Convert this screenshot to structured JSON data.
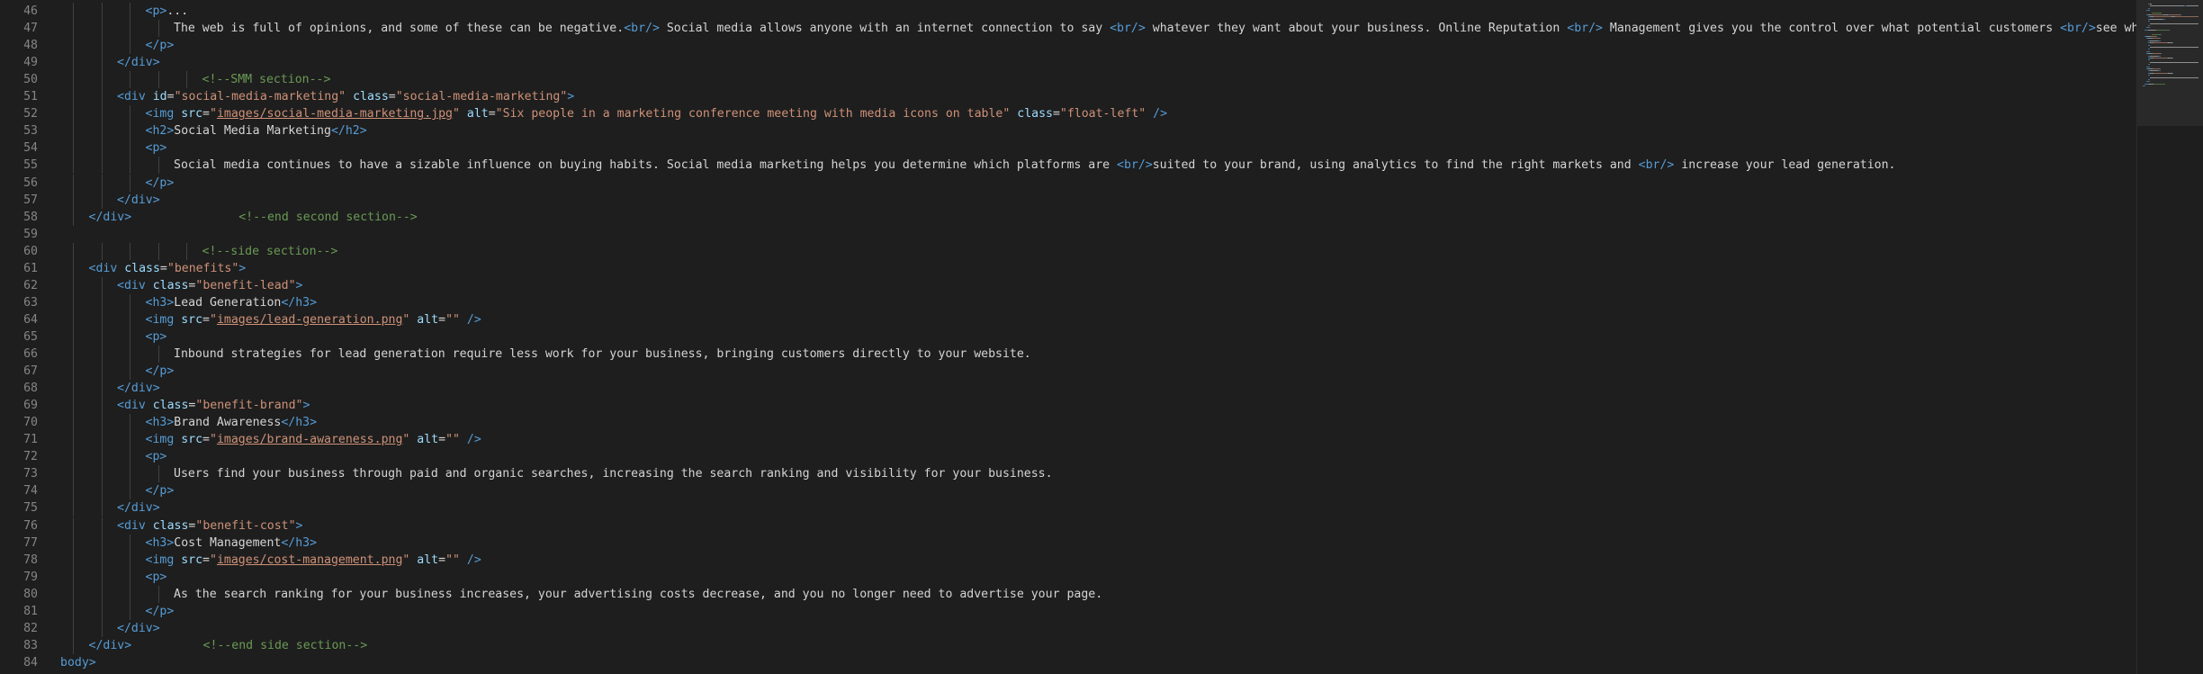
{
  "editor": {
    "theme_colors": {
      "background": "#1e1e1e",
      "line_number": "#858585",
      "punct": "#808080",
      "tag": "#569cd6",
      "attr": "#9cdcfe",
      "string": "#ce9178",
      "comment": "#6a9955",
      "text": "#d4d4d4"
    },
    "lines": [
      {
        "n": "46",
        "indent": 3,
        "tokens": [
          [
            "tag",
            "<p>"
          ],
          [
            "text",
            "..."
          ]
        ]
      },
      {
        "n": "46b",
        "hidden": true,
        "indent": 0,
        "tokens": []
      },
      {
        "n": "47",
        "indent": 4,
        "tokens": [
          [
            "text",
            "The web is full of opinions, and some of these can be negative."
          ],
          [
            "tag",
            "<br/>"
          ],
          [
            "text",
            " Social media allows anyone with an internet connection to say "
          ],
          [
            "tag",
            "<br/>"
          ],
          [
            "text",
            " whatever they want about your business. Online Reputation "
          ],
          [
            "tag",
            "<br/>"
          ],
          [
            "text",
            " Management gives you the control over what potential customers "
          ],
          [
            "tag",
            "<br/>"
          ],
          [
            "text",
            "see when they sea"
          ]
        ]
      },
      {
        "n": "48",
        "indent": 3,
        "tokens": [
          [
            "tag",
            "</p>"
          ]
        ]
      },
      {
        "n": "49",
        "indent": 2,
        "tokens": [
          [
            "tag",
            "</div>"
          ]
        ]
      },
      {
        "n": "50",
        "indent": 5,
        "tokens": [
          [
            "comment",
            "<!--SMM section-->"
          ]
        ]
      },
      {
        "n": "51",
        "indent": 2,
        "tokens": [
          [
            "tag",
            "<div"
          ],
          [
            "text",
            " "
          ],
          [
            "attr",
            "id"
          ],
          [
            "text",
            "="
          ],
          [
            "str",
            "\"social-media-marketing\""
          ],
          [
            "text",
            " "
          ],
          [
            "attr",
            "class"
          ],
          [
            "text",
            "="
          ],
          [
            "str",
            "\"social-media-marketing\""
          ],
          [
            "tag",
            ">"
          ]
        ]
      },
      {
        "n": "52",
        "indent": 3,
        "tokens": [
          [
            "tag",
            "<img"
          ],
          [
            "text",
            " "
          ],
          [
            "attr",
            "src"
          ],
          [
            "text",
            "="
          ],
          [
            "str",
            "\""
          ],
          [
            "link",
            "images/social-media-marketing.jpg"
          ],
          [
            "str",
            "\""
          ],
          [
            "text",
            " "
          ],
          [
            "attr",
            "alt"
          ],
          [
            "text",
            "="
          ],
          [
            "str",
            "\"Six people in a marketing conference meeting with media icons on table\""
          ],
          [
            "text",
            " "
          ],
          [
            "attr",
            "class"
          ],
          [
            "text",
            "="
          ],
          [
            "str",
            "\"float-left\""
          ],
          [
            "text",
            " "
          ],
          [
            "tag",
            "/>"
          ]
        ]
      },
      {
        "n": "53",
        "indent": 3,
        "tokens": [
          [
            "tag",
            "<h2>"
          ],
          [
            "text",
            "Social Media Marketing"
          ],
          [
            "tag",
            "</h2>"
          ]
        ]
      },
      {
        "n": "54",
        "indent": 3,
        "tokens": [
          [
            "tag",
            "<p>"
          ]
        ]
      },
      {
        "n": "55",
        "indent": 4,
        "tokens": [
          [
            "text",
            "Social media continues to have a sizable influence on buying habits. Social media marketing helps you determine which platforms are "
          ],
          [
            "tag",
            "<br/>"
          ],
          [
            "text",
            "suited to your brand, using analytics to find the right markets and "
          ],
          [
            "tag",
            "<br/>"
          ],
          [
            "text",
            " increase your lead generation."
          ]
        ]
      },
      {
        "n": "56",
        "indent": 3,
        "tokens": [
          [
            "tag",
            "</p>"
          ]
        ]
      },
      {
        "n": "57",
        "indent": 2,
        "tokens": [
          [
            "tag",
            "</div>"
          ]
        ]
      },
      {
        "n": "58",
        "indent": 1,
        "tokens": [
          [
            "tag",
            "</div>"
          ],
          [
            "text",
            "               "
          ],
          [
            "comment",
            "<!--end second section-->"
          ]
        ]
      },
      {
        "n": "59",
        "indent": 0,
        "tokens": []
      },
      {
        "n": "60",
        "indent": 5,
        "tokens": [
          [
            "comment",
            "<!--side section-->"
          ]
        ]
      },
      {
        "n": "61",
        "indent": 1,
        "tokens": [
          [
            "tag",
            "<div"
          ],
          [
            "text",
            " "
          ],
          [
            "attr",
            "class"
          ],
          [
            "text",
            "="
          ],
          [
            "str",
            "\"benefits\""
          ],
          [
            "tag",
            ">"
          ]
        ]
      },
      {
        "n": "62",
        "indent": 2,
        "tokens": [
          [
            "tag",
            "<div"
          ],
          [
            "text",
            " "
          ],
          [
            "attr",
            "class"
          ],
          [
            "text",
            "="
          ],
          [
            "str",
            "\"benefit-lead\""
          ],
          [
            "tag",
            ">"
          ]
        ]
      },
      {
        "n": "63",
        "indent": 3,
        "tokens": [
          [
            "tag",
            "<h3>"
          ],
          [
            "text",
            "Lead Generation"
          ],
          [
            "tag",
            "</h3>"
          ]
        ]
      },
      {
        "n": "64",
        "indent": 3,
        "tokens": [
          [
            "tag",
            "<img"
          ],
          [
            "text",
            " "
          ],
          [
            "attr",
            "src"
          ],
          [
            "text",
            "="
          ],
          [
            "str",
            "\""
          ],
          [
            "link",
            "images/lead-generation.png"
          ],
          [
            "str",
            "\""
          ],
          [
            "text",
            " "
          ],
          [
            "attr",
            "alt"
          ],
          [
            "text",
            "="
          ],
          [
            "str",
            "\"\""
          ],
          [
            "text",
            " "
          ],
          [
            "tag",
            "/>"
          ]
        ]
      },
      {
        "n": "65",
        "indent": 3,
        "tokens": [
          [
            "tag",
            "<p>"
          ]
        ]
      },
      {
        "n": "66",
        "indent": 4,
        "tokens": [
          [
            "text",
            "Inbound strategies for lead generation require less work for your business, bringing customers directly to your website."
          ]
        ]
      },
      {
        "n": "67",
        "indent": 3,
        "tokens": [
          [
            "tag",
            "</p>"
          ]
        ]
      },
      {
        "n": "68",
        "indent": 2,
        "tokens": [
          [
            "tag",
            "</div>"
          ]
        ]
      },
      {
        "n": "69",
        "indent": 2,
        "tokens": [
          [
            "tag",
            "<div"
          ],
          [
            "text",
            " "
          ],
          [
            "attr",
            "class"
          ],
          [
            "text",
            "="
          ],
          [
            "str",
            "\"benefit-brand\""
          ],
          [
            "tag",
            ">"
          ]
        ]
      },
      {
        "n": "70",
        "indent": 3,
        "tokens": [
          [
            "tag",
            "<h3>"
          ],
          [
            "text",
            "Brand Awareness"
          ],
          [
            "tag",
            "</h3>"
          ]
        ]
      },
      {
        "n": "71",
        "indent": 3,
        "tokens": [
          [
            "tag",
            "<img"
          ],
          [
            "text",
            " "
          ],
          [
            "attr",
            "src"
          ],
          [
            "text",
            "="
          ],
          [
            "str",
            "\""
          ],
          [
            "link",
            "images/brand-awareness.png"
          ],
          [
            "str",
            "\""
          ],
          [
            "text",
            " "
          ],
          [
            "attr",
            "alt"
          ],
          [
            "text",
            "="
          ],
          [
            "str",
            "\"\""
          ],
          [
            "text",
            " "
          ],
          [
            "tag",
            "/>"
          ]
        ]
      },
      {
        "n": "72",
        "indent": 3,
        "tokens": [
          [
            "tag",
            "<p>"
          ]
        ]
      },
      {
        "n": "73",
        "indent": 4,
        "tokens": [
          [
            "text",
            "Users find your business through paid and organic searches, increasing the search ranking and visibility for your business."
          ]
        ]
      },
      {
        "n": "74",
        "indent": 3,
        "tokens": [
          [
            "tag",
            "</p>"
          ]
        ]
      },
      {
        "n": "75",
        "indent": 2,
        "tokens": [
          [
            "tag",
            "</div>"
          ]
        ]
      },
      {
        "n": "76",
        "indent": 2,
        "tokens": [
          [
            "tag",
            "<div"
          ],
          [
            "text",
            " "
          ],
          [
            "attr",
            "class"
          ],
          [
            "text",
            "="
          ],
          [
            "str",
            "\"benefit-cost\""
          ],
          [
            "tag",
            ">"
          ]
        ]
      },
      {
        "n": "77",
        "indent": 3,
        "tokens": [
          [
            "tag",
            "<h3>"
          ],
          [
            "text",
            "Cost Management"
          ],
          [
            "tag",
            "</h3>"
          ]
        ]
      },
      {
        "n": "78",
        "indent": 3,
        "tokens": [
          [
            "tag",
            "<img"
          ],
          [
            "text",
            " "
          ],
          [
            "attr",
            "src"
          ],
          [
            "text",
            "="
          ],
          [
            "str",
            "\""
          ],
          [
            "link",
            "images/cost-management.png"
          ],
          [
            "str",
            "\""
          ],
          [
            "text",
            " "
          ],
          [
            "attr",
            "alt"
          ],
          [
            "text",
            "="
          ],
          [
            "str",
            "\"\""
          ],
          [
            "text",
            " "
          ],
          [
            "tag",
            "/>"
          ]
        ]
      },
      {
        "n": "79",
        "indent": 3,
        "tokens": [
          [
            "tag",
            "<p>"
          ]
        ]
      },
      {
        "n": "80",
        "indent": 4,
        "tokens": [
          [
            "text",
            "As the search ranking for your business increases, your advertising costs decrease, and you no longer need to advertise your page."
          ]
        ]
      },
      {
        "n": "81",
        "indent": 3,
        "tokens": [
          [
            "tag",
            "</p>"
          ]
        ]
      },
      {
        "n": "82",
        "indent": 2,
        "tokens": [
          [
            "tag",
            "</div>"
          ]
        ]
      },
      {
        "n": "83",
        "indent": 1,
        "tokens": [
          [
            "tag",
            "</div>"
          ],
          [
            "text",
            "          "
          ],
          [
            "comment",
            "<!--end side section-->"
          ]
        ]
      },
      {
        "n": "84",
        "indent": 0,
        "tokens": [
          [
            "tag",
            "body>"
          ]
        ]
      }
    ]
  }
}
